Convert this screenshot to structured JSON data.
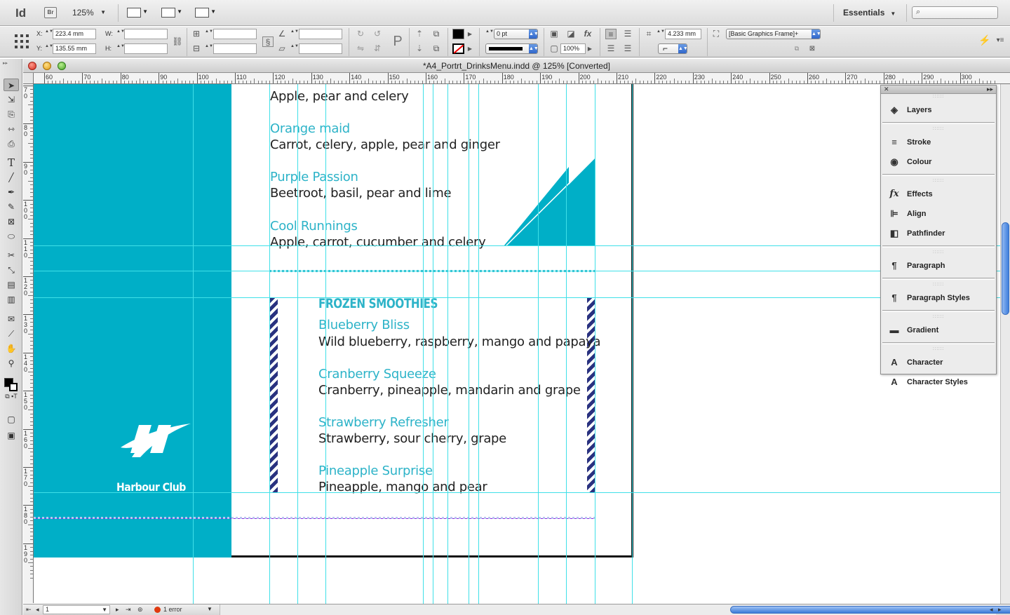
{
  "app": {
    "logo": "Id",
    "bridge": "Br",
    "zoom": "125%",
    "workspace": "Essentials",
    "search_placeholder": ""
  },
  "control": {
    "x_label": "X:",
    "x_value": "223.4 mm",
    "y_label": "Y:",
    "y_value": "135.55 mm",
    "w_label": "W:",
    "h_label": "H:",
    "stroke_weight": "0 pt",
    "opacity": "100%",
    "offset": "4.233 mm",
    "object_style": "[Basic Graphics Frame]+"
  },
  "document": {
    "title": "*A4_Portrt_DrinksMenu.indd @ 125% [Converted]"
  },
  "ruler": {
    "h_labels": [
      "60",
      "70",
      "80",
      "90",
      "100",
      "110",
      "120",
      "130",
      "140",
      "150",
      "160",
      "170",
      "180",
      "190",
      "200",
      "210",
      "220",
      "230",
      "240",
      "250",
      "260",
      "270",
      "280",
      "290",
      "300"
    ],
    "v_labels": [
      "70",
      "80",
      "90",
      "100",
      "110",
      "120",
      "130",
      "140",
      "150",
      "160",
      "170",
      "180",
      "190"
    ]
  },
  "menu": {
    "items_top": [
      {
        "name": "Apple, pear and celery"
      },
      {
        "title": "Orange maid",
        "desc": "Carrot, celery, apple, pear and ginger"
      },
      {
        "title": "Purple Passion",
        "desc": "Beetroot, basil, pear and lime"
      },
      {
        "title": "Cool Runnings",
        "desc": "Apple, carrot, cucumber and celery"
      }
    ],
    "section_title": "FROZEN SMOOTHIES",
    "smoothies": [
      {
        "title": "Blueberry Bliss",
        "desc": "Wild blueberry, raspberry, mango and papaya"
      },
      {
        "title": "Cranberry Squeeze",
        "desc": "Cranberry, pineapple, mandarin and grape"
      },
      {
        "title": "Strawberry Refresher",
        "desc": "Strawberry, sour cherry, grape"
      },
      {
        "title": "Pineapple Surprise",
        "desc": "Pineapple, mango and pear"
      }
    ],
    "logo_text": "Harbour Club"
  },
  "panel": {
    "items": [
      {
        "label": "Layers",
        "icon": "layers-icon"
      },
      {
        "label": "Stroke",
        "icon": "stroke-icon"
      },
      {
        "label": "Colour",
        "icon": "colour-icon"
      },
      {
        "label": "Effects",
        "icon": "effects-icon"
      },
      {
        "label": "Align",
        "icon": "align-icon"
      },
      {
        "label": "Pathfinder",
        "icon": "pathfinder-icon"
      },
      {
        "label": "Paragraph",
        "icon": "paragraph-icon"
      },
      {
        "label": "Paragraph Styles",
        "icon": "paragraph-styles-icon"
      },
      {
        "label": "Gradient",
        "icon": "gradient-icon"
      },
      {
        "label": "Character",
        "icon": "character-icon"
      },
      {
        "label": "Character Styles",
        "icon": "character-styles-icon"
      }
    ]
  },
  "status": {
    "page": "1",
    "preflight": "1 error"
  },
  "colors": {
    "teal": "#00afc7",
    "guide": "#3fe0e8",
    "margin": "#8b2be0",
    "stripe": "#2a3280"
  }
}
